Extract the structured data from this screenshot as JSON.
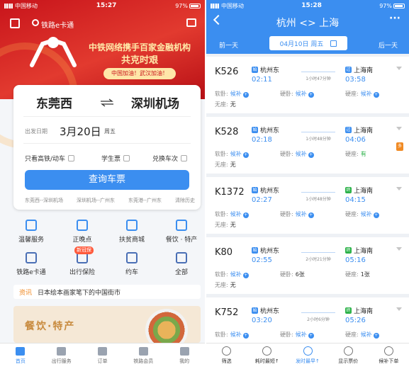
{
  "left": {
    "status": {
      "carrier": "中国移动",
      "time": "15:27",
      "battery": "97%"
    },
    "topbar": {
      "search_label": "铁路e卡通"
    },
    "banner": {
      "line1": "中铁网络携手百家金融机构",
      "line2": "共克时艰",
      "pill": "中国加油！武汉加油！"
    },
    "search": {
      "from": "东莞西",
      "to": "深圳机场",
      "date_label": "出发日期",
      "date": "3月20日",
      "weekday": "周五",
      "opt_gaotie": "只看高铁/动车",
      "opt_student": "学生票",
      "opt_transfer": "兑换车次",
      "query_label": "查询车票",
      "history": [
        "东莞西--深圳机场",
        "深圳机场--广州东",
        "东莞港--广州东",
        "清除历史"
      ]
    },
    "services": [
      {
        "label": "温馨服务"
      },
      {
        "label": "正晚点"
      },
      {
        "label": "扶贫商城"
      },
      {
        "label": "餐饮 · 特产"
      },
      {
        "label": "铁路e卡通"
      },
      {
        "label": "出行保险"
      },
      {
        "label": "约车"
      },
      {
        "label": "全部"
      }
    ],
    "new_tag": "新冠保",
    "news": {
      "tag": "资讯",
      "text": "日本绘本画家笔下的中国街市"
    },
    "promo": {
      "title": "餐饮·特产"
    },
    "tabs": [
      {
        "label": "首页"
      },
      {
        "label": "出行服务"
      },
      {
        "label": "订单"
      },
      {
        "label": "铁路会员"
      },
      {
        "label": "我的"
      }
    ]
  },
  "right": {
    "status": {
      "carrier": "中国移动",
      "time": "15:28",
      "battery": "97%"
    },
    "title": "杭州 <> 上海",
    "prev": "前一天",
    "next": "后一天",
    "date": "04月10日 周五",
    "more": "···",
    "trains": [
      {
        "no": "K526",
        "from": "杭州东",
        "to": "上海南",
        "dep": "02:11",
        "arr": "03:58",
        "dur": "1小时47分钟",
        "s1_label": "软卧:",
        "s1_val": "候补",
        "s2_label": "硬卧:",
        "s2_val": "候补",
        "s3_label": "硬座:",
        "s3_val": "候补",
        "s4_label": "无座:",
        "s4_val": "无"
      },
      {
        "no": "K528",
        "from": "杭州东",
        "to": "上海南",
        "dep": "02:18",
        "arr": "04:06",
        "dur": "1小时48分钟",
        "badge": "多",
        "s1_label": "软卧:",
        "s1_val": "候补",
        "s2_label": "硬卧:",
        "s2_val": "候补",
        "s3_label": "硬座:",
        "s3_val": "有",
        "s4_label": "无座:",
        "s4_val": "无"
      },
      {
        "no": "K1372",
        "from": "杭州东",
        "to": "上海南",
        "dep": "02:27",
        "arr": "04:15",
        "dur": "1小时48分钟",
        "s1_label": "软卧:",
        "s1_val": "候补",
        "s2_label": "硬卧:",
        "s2_val": "候补",
        "s3_label": "硬座:",
        "s3_val": "候补",
        "s4_label": "无座:",
        "s4_val": "无"
      },
      {
        "no": "K80",
        "from": "杭州东",
        "to": "上海南",
        "dep": "02:55",
        "arr": "05:16",
        "dur": "2小时21分钟",
        "s1_label": "软卧:",
        "s1_val": "候补",
        "s2_label": "硬卧:",
        "s2_val": "6张",
        "s3_label": "硬座:",
        "s3_val": "1张",
        "s4_label": "无座:",
        "s4_val": "无"
      },
      {
        "no": "K752",
        "from": "杭州东",
        "to": "上海南",
        "dep": "03:20",
        "arr": "05:26",
        "dur": "2小时6分钟",
        "s1_label": "软卧:",
        "s1_val": "候补",
        "s2_label": "硬卧:",
        "s2_val": "候补",
        "s3_label": "硬座:",
        "s3_val": "候补",
        "s4_label": "",
        "s4_val": ""
      }
    ],
    "tabs": [
      {
        "label": "筛选"
      },
      {
        "label": "耗时最短↑"
      },
      {
        "label": "发时最早↑"
      },
      {
        "label": "显示票价"
      },
      {
        "label": "候补下单"
      }
    ],
    "colors": {
      "accent": "#3b8ef0",
      "green": "#2db24a",
      "orange": "#f08a24"
    }
  }
}
